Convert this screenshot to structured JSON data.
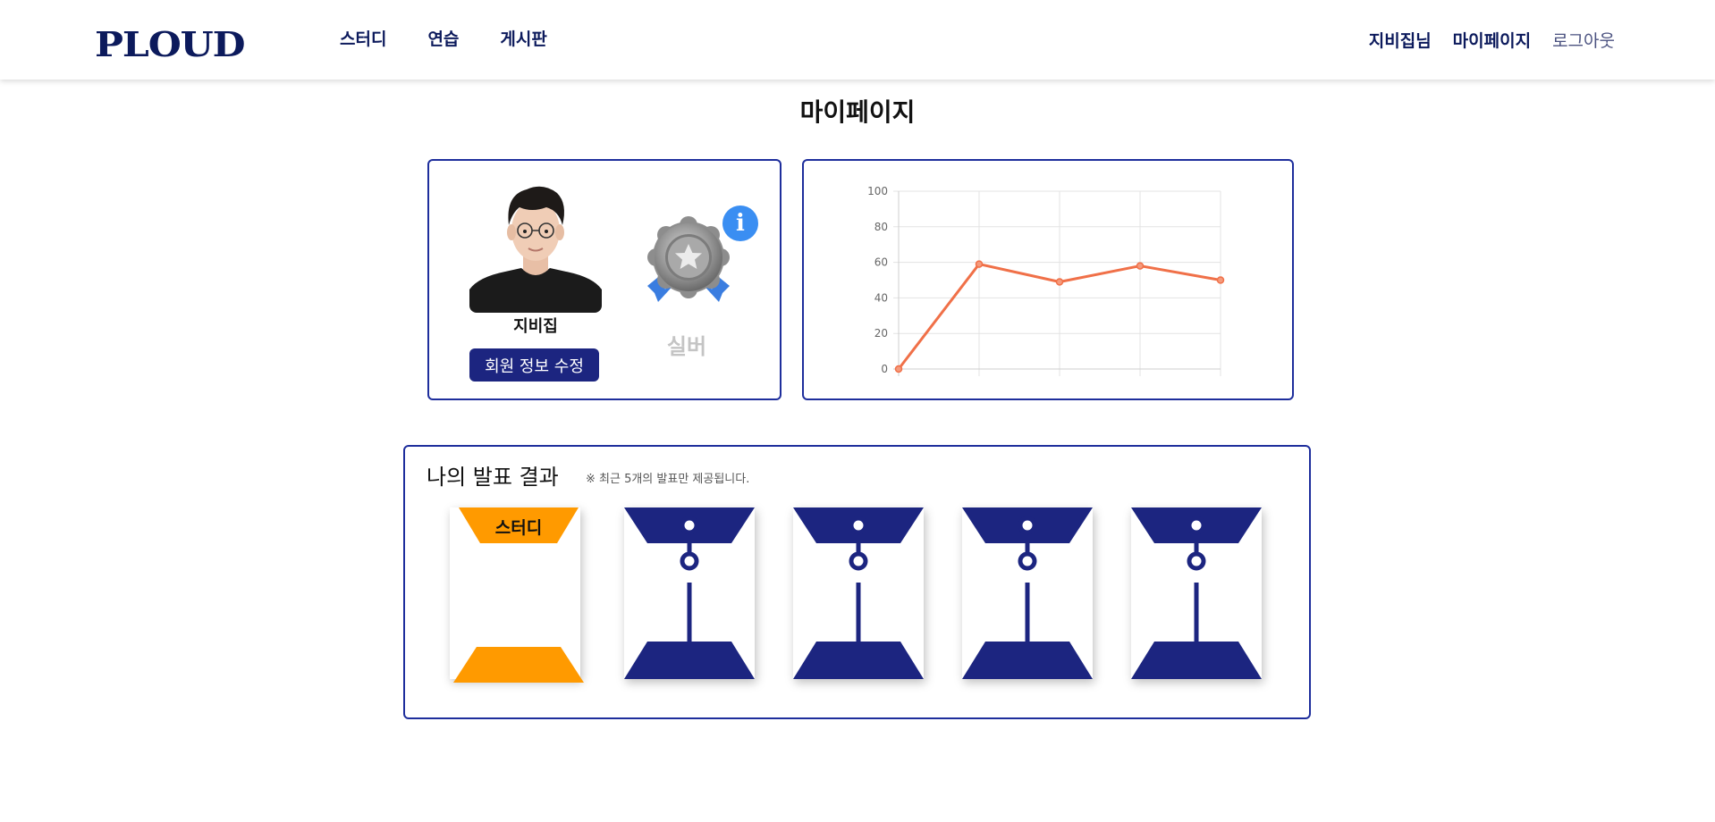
{
  "header": {
    "logo": "PLOUD",
    "nav": [
      "스터디",
      "연습",
      "게시판"
    ],
    "greeting": "지비집님",
    "mypage": "마이페이지",
    "logout": "로그아웃"
  },
  "page_title": "마이페이지",
  "profile": {
    "name": "지비집",
    "edit_button": "회원 정보 수정",
    "tier": "실버",
    "medal_icon": "silver-medal-icon",
    "info_icon": "info-icon"
  },
  "chart_data": {
    "type": "line",
    "x": [
      1,
      2,
      3,
      4,
      5
    ],
    "values": [
      0,
      59,
      49,
      58,
      50
    ],
    "ylim": [
      0,
      100
    ],
    "yticks": [
      0,
      20,
      40,
      60,
      80,
      100
    ],
    "color": "#f07048",
    "grid": true
  },
  "results": {
    "title": "나의 발표 결과",
    "note": "※ 최근 5개의 발표만 제공됩니다.",
    "cards": [
      {
        "type": "study",
        "label": "스터디",
        "color": "#ff9a00"
      },
      {
        "type": "practice",
        "label": "",
        "color": "#1c2580"
      },
      {
        "type": "practice",
        "label": "",
        "color": "#1c2580"
      },
      {
        "type": "practice",
        "label": "",
        "color": "#1c2580"
      },
      {
        "type": "practice",
        "label": "",
        "color": "#1c2580"
      }
    ]
  }
}
